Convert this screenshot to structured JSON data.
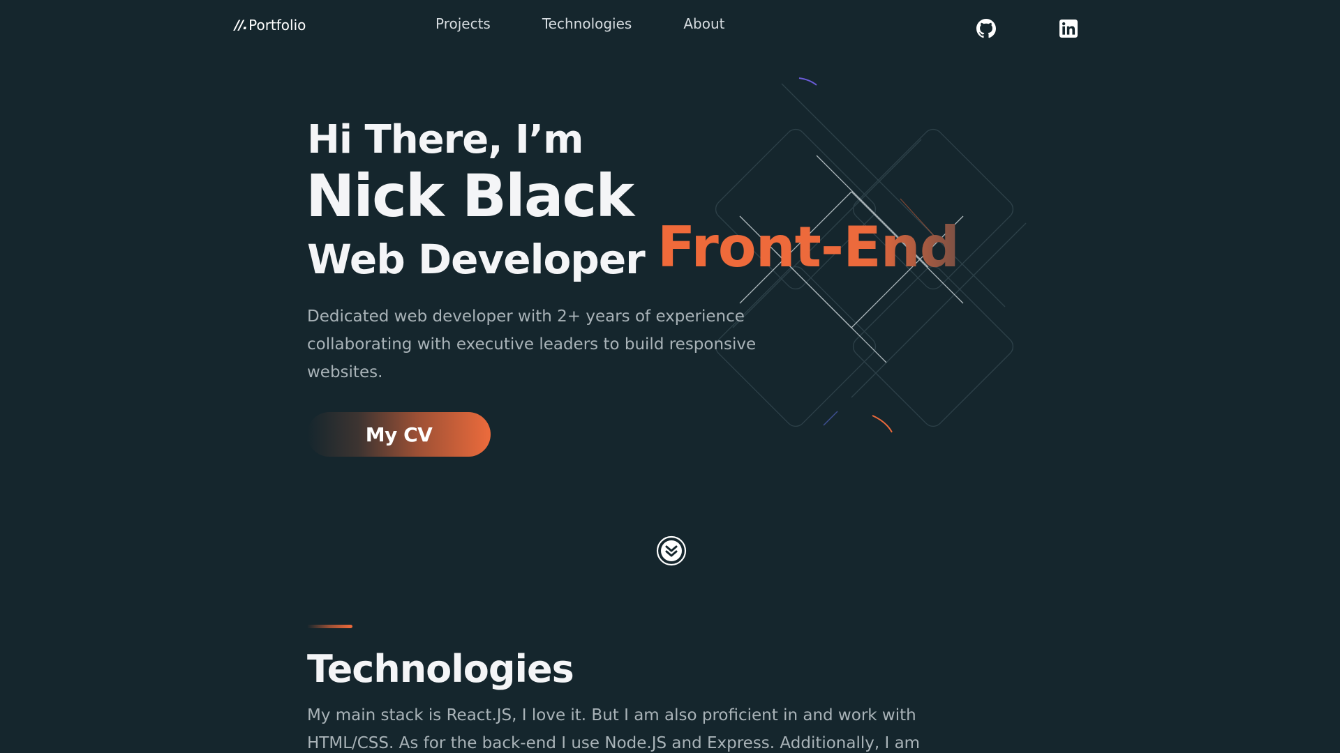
{
  "nav": {
    "logo_mark": "//.",
    "logo_text": "Portfolio",
    "links": [
      "Projects",
      "Technologies",
      "About"
    ],
    "social": [
      {
        "icon": "github-icon"
      },
      {
        "icon": "linkedin-icon"
      }
    ]
  },
  "hero": {
    "greeting": "Hi There, I’m",
    "name": "Nick Black",
    "role": "Web Developer",
    "role_accent": "Front-End",
    "intro": "Dedicated web developer with 2+ years of experience collaborating with executive leaders to build responsive websites.",
    "cv_button": "My CV",
    "scroll_icon": "chevrons-down-icon"
  },
  "technologies": {
    "title": "Technologies",
    "text": "My main stack is React.JS, I love it. But I am also proficient in and work with HTML/CSS. As for the back-end I use Node.JS and Express. Additionally, I am"
  },
  "colors": {
    "background": "#15262d",
    "accent": "#ec6a3c",
    "text_primary": "#f4f5f7",
    "text_muted": "#a9b3b8"
  }
}
